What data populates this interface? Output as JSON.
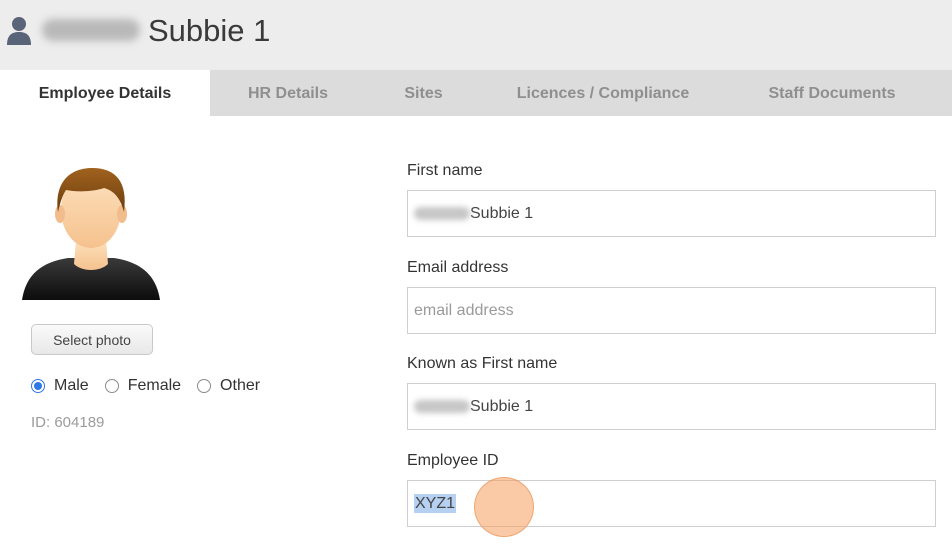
{
  "header": {
    "icon": "user-icon",
    "title": "Subbie 1"
  },
  "tabs": [
    {
      "label": "Employee Details",
      "active": true
    },
    {
      "label": "HR Details",
      "active": false
    },
    {
      "label": "Sites",
      "active": false
    },
    {
      "label": "Licences / Compliance",
      "active": false
    },
    {
      "label": "Staff Documents",
      "active": false
    }
  ],
  "profile": {
    "select_photo_label": "Select photo",
    "gender_options": [
      {
        "label": "Male",
        "checked": true
      },
      {
        "label": "Female",
        "checked": false
      },
      {
        "label": "Other",
        "checked": false
      }
    ],
    "id_text": "ID: 604189"
  },
  "form": {
    "first_name": {
      "label": "First name",
      "value": "Subbie 1"
    },
    "email": {
      "label": "Email address",
      "value": "",
      "placeholder": "email address"
    },
    "known_as": {
      "label": "Known as First name",
      "value": "Subbie 1"
    },
    "employee_id": {
      "label": "Employee ID",
      "value": "XYZ1"
    }
  },
  "colors": {
    "accent": "#2f78e5",
    "selection": "#b5d0f0",
    "touch_indicator": "#f59e5c"
  }
}
